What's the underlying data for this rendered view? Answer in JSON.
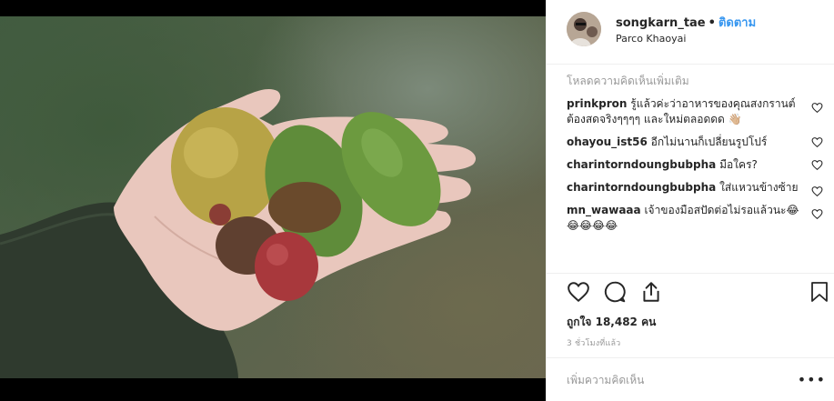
{
  "header": {
    "username": "songkarn_tae",
    "separator": "•",
    "follow_label": "ติดตาม",
    "location": "Parco Khaoyai"
  },
  "comments": {
    "load_more": "โหลดความคิดเห็นเพิ่มเติม",
    "items": [
      {
        "user": "prinkpron",
        "text": "รู้แล้วค่ะว่าอาหารของคุณสงกรานต์ ต้องสดจริงๆๆๆๆ และใหม่ตลอดดด 👋🏼"
      },
      {
        "user": "ohayou_ist56",
        "text": "อีกไม่นานก็เปลี่ยนรูปโปร์"
      },
      {
        "user": "charintorndoungbubpha",
        "text": "มือใคร?"
      },
      {
        "user": "charintorndoungbubpha",
        "text": "ใส่แหวนข้างซ้าย"
      },
      {
        "user": "mn_wawaaa",
        "text": "เจ้าของมือสปัดต่อไม่รอแล้วนะ😂😂😂😂😂"
      }
    ]
  },
  "actions": {
    "like_icon": "heart-icon",
    "comment_icon": "comment-icon",
    "share_icon": "share-icon",
    "save_icon": "bookmark-icon"
  },
  "likes": {
    "label": "ถูกใจ 18,482 คน"
  },
  "timestamp": "3 ชั่วโมงที่แล้ว",
  "add_comment": {
    "placeholder": "เพิ่มความคิดเห็น",
    "more": "•••"
  },
  "colors": {
    "accent": "#3897f0",
    "muted": "#999999",
    "text": "#262626"
  }
}
